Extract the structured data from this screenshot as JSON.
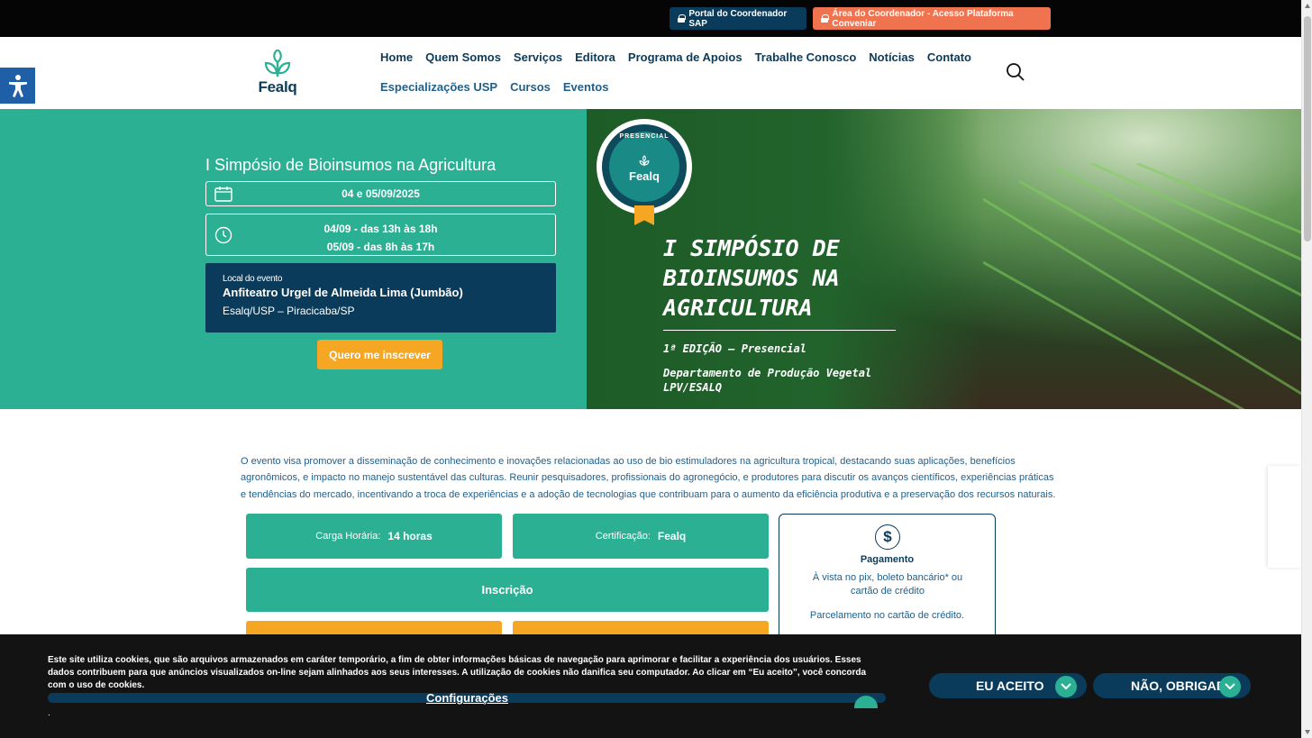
{
  "topbar": {
    "sap_label": "Portal do Coordenador SAP",
    "conveniar_label": "Área do Coordenador - Acesso Plataforma Conveniar"
  },
  "header": {
    "logo_text": "Fealq",
    "nav_primary": [
      "Home",
      "Quem Somos",
      "Serviços",
      "Editora",
      "Programa de Apoios",
      "Trabalhe Conosco",
      "Notícias",
      "Contato"
    ],
    "nav_secondary": [
      "Especializações USP",
      "Cursos",
      "Eventos"
    ]
  },
  "hero": {
    "event_title": "I Simpósio de Bioinsumos na Agricultura",
    "date": "04 e 05/09/2025",
    "time_line1": "04/09 - das 13h às 18h",
    "time_line2": "05/09 - das 8h às 17h",
    "venue_label": "Local do evento",
    "venue_name": "Anfiteatro Urgel de Almeida Lima (Jumbão)",
    "venue_city": "Esalq/USP – Piracicaba/SP",
    "cta_label": "Quero me inscrever",
    "badge_top": "PRESENCIAL",
    "badge_logo": "Fealq",
    "banner_heading": "I SIMPÓSIO DE BIOINSUMOS NA AGRICULTURA",
    "banner_edition": "1ª EDIÇÃO – Presencial",
    "banner_dept_line1": "Departamento de Produção Vegetal",
    "banner_dept_line2": "LPV/ESALQ"
  },
  "content": {
    "description": "O evento visa promover a disseminação de conhecimento e inovações relacionadas ao uso de bio estimuladores na agricultura tropical, destacando suas aplicações, benefícios agronômicos, e impacto no manejo sustentável das culturas. Reunir pesquisadores, profissionais do agronegócio, e produtores para discutir os avanços científicos, experiências práticas e tendências do mercado, incentivando a troca de experiências e a adoção de tecnologias que contribuam para o aumento da eficiência produtiva e a preservação dos recursos naturais.",
    "hours_label": "Carga Horária:",
    "hours_value": "14 horas",
    "cert_label": "Certificação:",
    "cert_value": "Fealq",
    "registration_label": "Inscrição",
    "payment_icon": "$",
    "payment_title": "Pagamento",
    "payment_text": "À vista no pix, boleto bancário* ou cartão de crédito",
    "payment_installments": "Parcelamento no cartão de crédito."
  },
  "cookie": {
    "text": "Este site utiliza cookies, que são arquivos armazenados em caráter temporário, a fim de obter informações básicas de navegação para aprimorar e facilitar a experiência dos usuários. Esses dados contribuem para que anúncios visualizados on-line sejam alinhados aos seus interesses. A utilização de cookies não danifica seu computador. Ao clicar em “Eu aceito”, você concorda com o uso de cookies.",
    "config_label": "Configurações",
    "trailing_dot": ".",
    "accept_label": "EU ACEITO",
    "decline_label": "NÃO, OBRIGADO"
  },
  "colors": {
    "teal": "#2bb094",
    "navy": "#0b3b5a",
    "orange": "#f5a623",
    "coral": "#f07350",
    "accessibility_blue": "#1f5fa7"
  },
  "icons": [
    "lock-icon",
    "search-icon",
    "accessibility-icon",
    "calendar-icon",
    "clock-icon",
    "dollar-icon",
    "check-icon",
    "sprout-logo-icon"
  ]
}
